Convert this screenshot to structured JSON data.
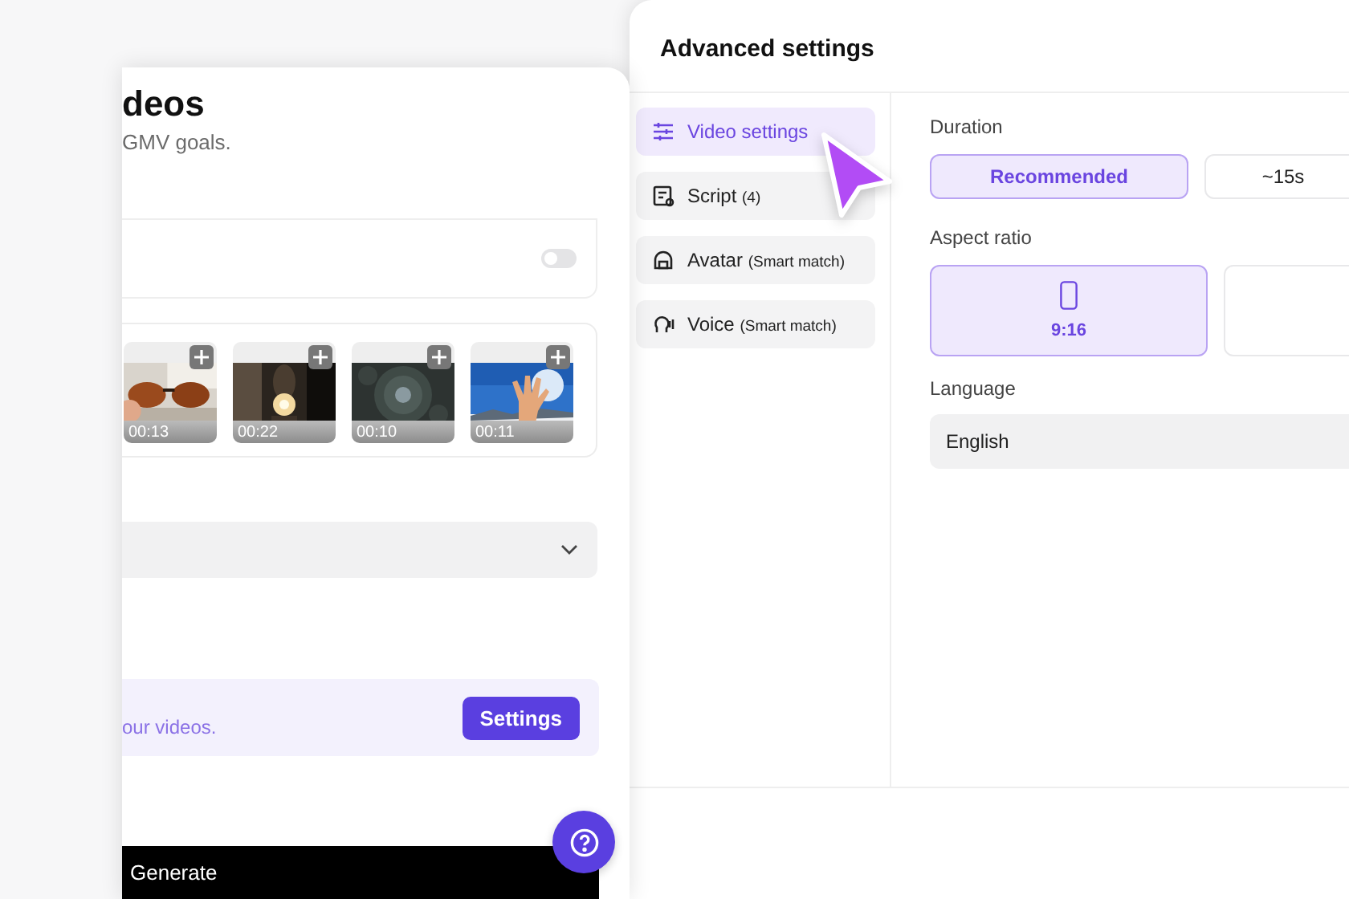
{
  "back_card": {
    "title": "deos",
    "subtitle": "GMV goals.",
    "toggle": {
      "on": false
    },
    "clips": [
      {
        "duration": "00:13"
      },
      {
        "duration": "00:22"
      },
      {
        "duration": "00:10"
      },
      {
        "duration": "00:11"
      }
    ],
    "notice": {
      "text": "our videos.",
      "button": "Settings"
    },
    "generate_button": "Generate"
  },
  "panel": {
    "title": "Advanced settings",
    "nav": [
      {
        "label": "Video settings",
        "selected": true
      },
      {
        "label": "Script",
        "detail": "(4)",
        "selected": false
      },
      {
        "label": "Avatar",
        "detail": "(Smart match)",
        "selected": false
      },
      {
        "label": "Voice",
        "detail": "(Smart match)",
        "selected": false
      }
    ],
    "duration": {
      "label": "Duration",
      "options": [
        {
          "label": "Recommended",
          "selected": true
        },
        {
          "label": "~15s",
          "selected": false
        }
      ]
    },
    "aspect_ratio": {
      "label": "Aspect ratio",
      "options": [
        {
          "label": "9:16",
          "selected": true
        },
        {
          "selected": false
        }
      ]
    },
    "language": {
      "label": "Language",
      "value": "English"
    }
  }
}
